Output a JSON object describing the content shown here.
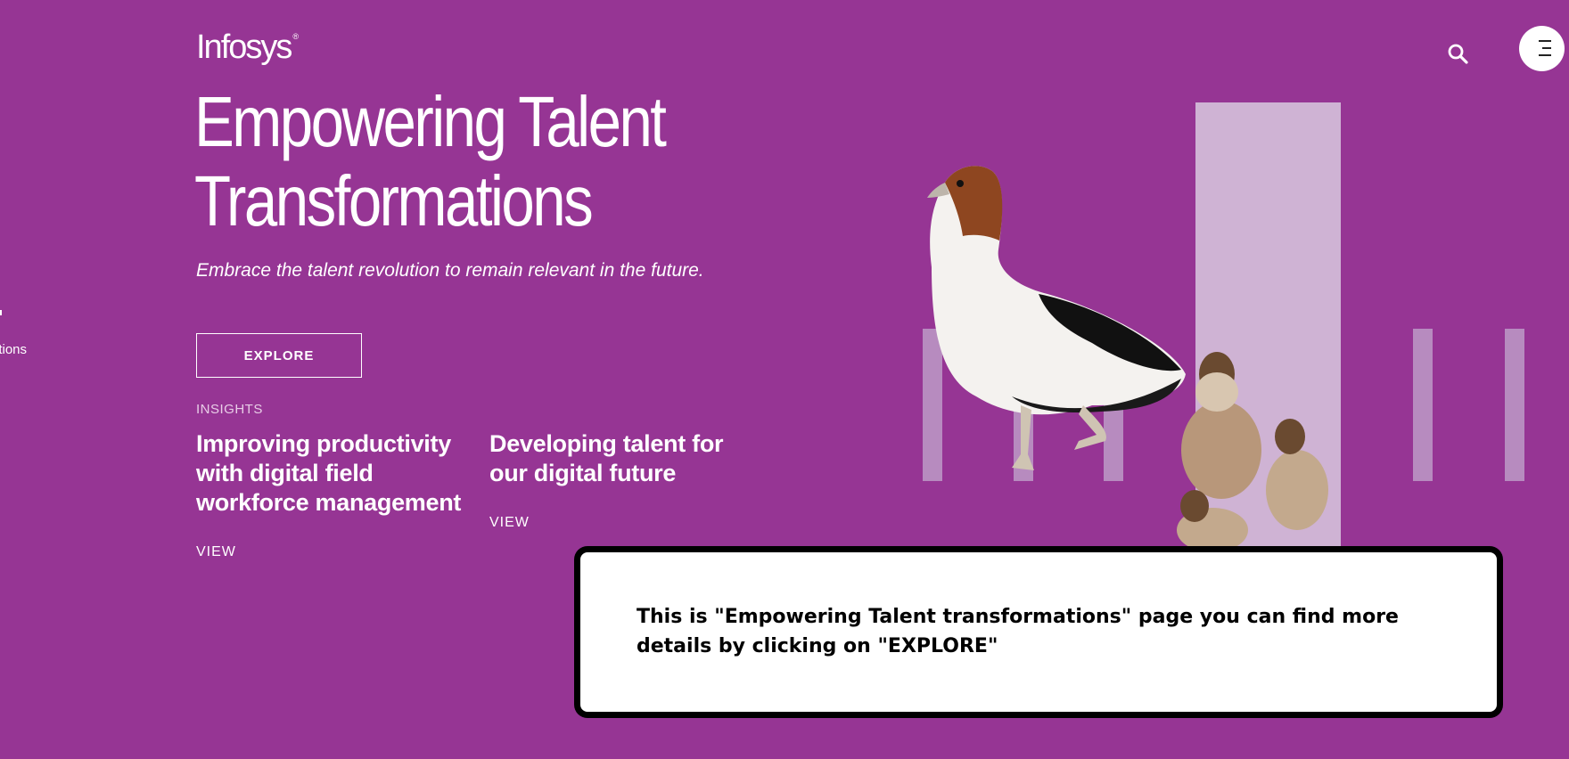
{
  "brand": {
    "logo_text": "Infosys",
    "logo_mark": "®"
  },
  "header": {
    "search_icon": "search-icon",
    "menu_icon": "hamburger-menu-icon"
  },
  "side_nav": {
    "partial_label": "ations"
  },
  "hero": {
    "title": "Empowering Talent Transformations",
    "subtitle": "Embrace the talent revolution to remain relevant in the future.",
    "cta_label": "EXPLORE"
  },
  "insights": {
    "label": "INSIGHTS",
    "items": [
      {
        "title": "Improving productivity with digital field workforce management",
        "link_label": "VIEW"
      },
      {
        "title": "Developing talent for our digital future",
        "link_label": "VIEW"
      }
    ]
  },
  "popup": {
    "message": "This is \"Empowering Talent transformations\" page you can find more details by clicking on \"EXPLORE\""
  },
  "colors": {
    "background": "#963594",
    "accent_bar": "#cfb3d4",
    "text": "#ffffff"
  }
}
